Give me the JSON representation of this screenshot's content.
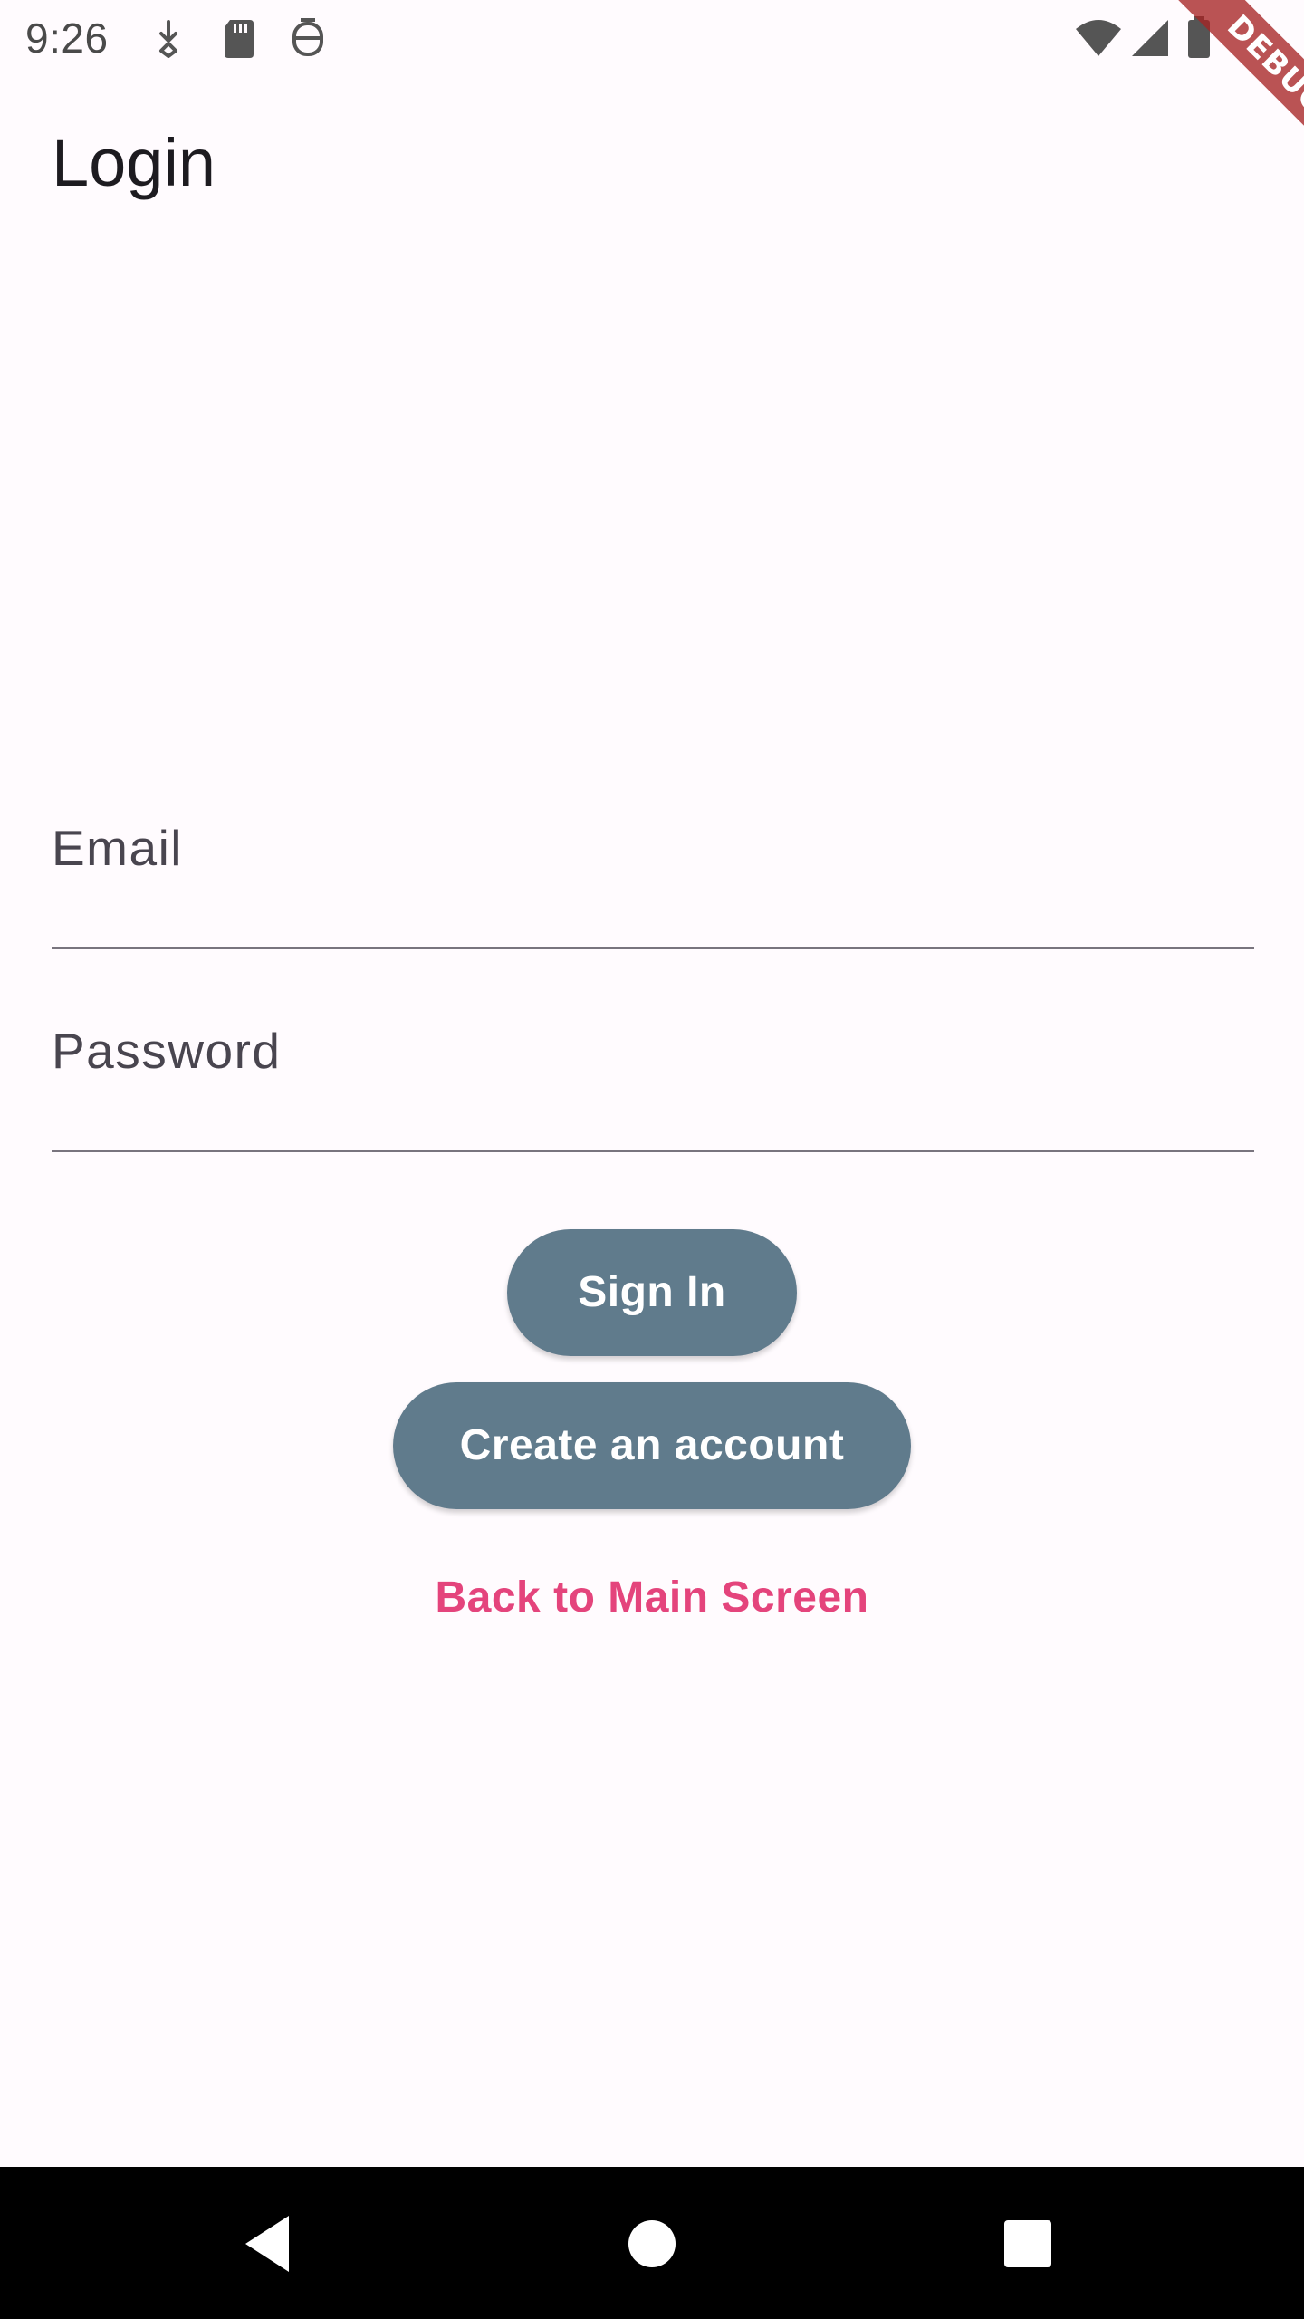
{
  "status_bar": {
    "time": "9:26",
    "left_icons": [
      "download-icon",
      "sd-card-icon",
      "robot-icon"
    ],
    "right_icons": [
      "wifi-icon",
      "cell-signal-icon",
      "battery-icon"
    ]
  },
  "debug_banner": {
    "label": "DEBUG",
    "color": "#a62424"
  },
  "app_bar": {
    "title": "Login"
  },
  "form": {
    "email": {
      "label": "Email",
      "value": ""
    },
    "password": {
      "label": "Password",
      "value": ""
    }
  },
  "actions": {
    "sign_in_label": "Sign In",
    "create_account_label": "Create an account",
    "back_link_label": "Back to Main Screen"
  },
  "nav_bar": {
    "buttons": [
      "back-icon",
      "home-icon",
      "recents-icon"
    ]
  },
  "colors": {
    "background": "#fffbfe",
    "button": "#607b8c",
    "link": "#e4447c",
    "underline": "#79747e"
  }
}
